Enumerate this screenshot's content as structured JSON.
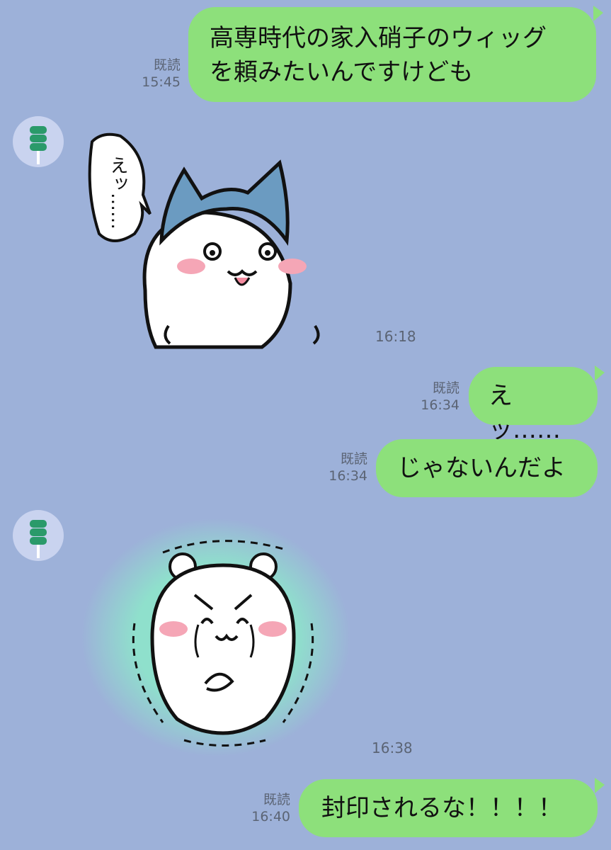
{
  "colors": {
    "background": "#9db1d9",
    "sent_bubble": "#8de07b",
    "meta_text": "#5b6474",
    "avatar_bg": "#c9d3ef",
    "avatar_icon": "#2a9a6a"
  },
  "messages": [
    {
      "direction": "sent",
      "type": "text",
      "lines": [
        "高専時代の家入硝子のウィッグ",
        "を頼みたいんですけども"
      ],
      "read_label": "既読",
      "time": "15:45"
    },
    {
      "direction": "received",
      "type": "sticker",
      "sticker_text": "えッ……",
      "avatar_icon": "dango-icon",
      "time": "16:18"
    },
    {
      "direction": "sent",
      "type": "text",
      "text": "えッ……",
      "read_label": "既読",
      "time": "16:34"
    },
    {
      "direction": "sent",
      "type": "text",
      "text": "じゃないんだよ",
      "read_label": "既読",
      "time": "16:34"
    },
    {
      "direction": "received",
      "type": "sticker",
      "avatar_icon": "dango-icon",
      "time": "16:38"
    },
    {
      "direction": "sent",
      "type": "text",
      "text": "封印されるな！！！！",
      "read_label": "既読",
      "time": "16:40"
    }
  ]
}
